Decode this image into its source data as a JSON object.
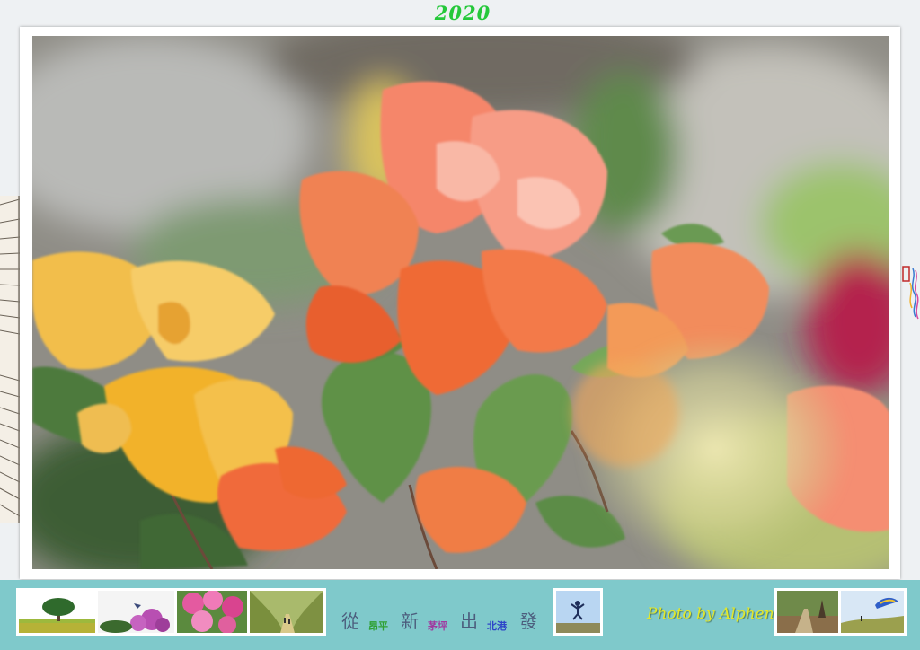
{
  "header": {
    "year": "2020"
  },
  "photo": {
    "subject": "bougainvillea-flowers",
    "colors": {
      "orange": "#f07a45",
      "salmon": "#f69a7a",
      "yellow": "#f1b73a",
      "leaf": "#6f9e52",
      "magenta": "#b32a52"
    }
  },
  "footer": {
    "background": "#7fc9cb",
    "slogan": {
      "chars": [
        {
          "text": "從",
          "size": "big",
          "color": "#4c5d7d"
        },
        {
          "text": "昂平",
          "size": "small",
          "color": "#2fa033"
        },
        {
          "text": "新",
          "size": "big",
          "color": "#4c5d7d"
        },
        {
          "text": "茅坪",
          "size": "small",
          "color": "#a03aa0"
        },
        {
          "text": "出",
          "size": "big",
          "color": "#4c5d7d"
        },
        {
          "text": "北港",
          "size": "small",
          "color": "#2d45c8"
        },
        {
          "text": "發",
          "size": "big",
          "color": "#4c5d7d"
        }
      ]
    },
    "credit": "Photo by Alphen"
  }
}
